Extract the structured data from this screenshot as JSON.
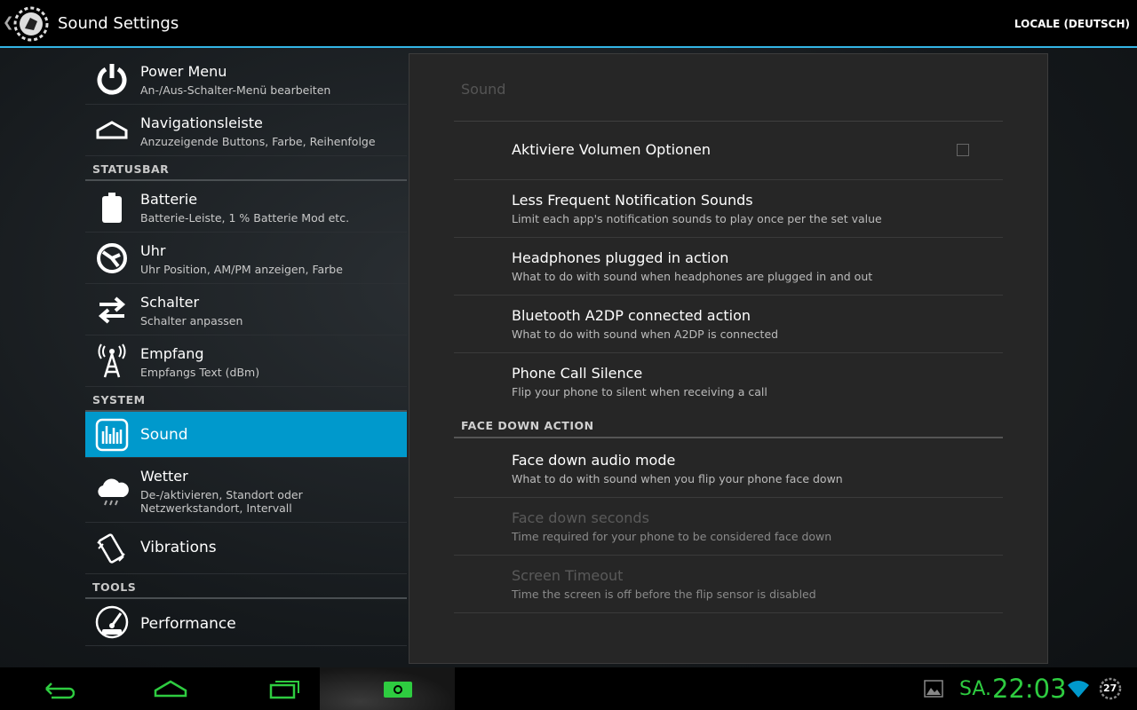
{
  "actionbar": {
    "title": "Sound Settings",
    "action": "LOCALE (DEUTSCH)",
    "back_glyph": "❮"
  },
  "sidebar": {
    "items": [
      {
        "title": "Power Menu",
        "subtitle": "An-/Aus-Schalter-Menü bearbeiten",
        "icon": "power-icon"
      },
      {
        "title": "Navigationsleiste",
        "subtitle": "Anzuzeigende Buttons, Farbe, Reihenfolge",
        "icon": "navbar-icon"
      },
      {
        "header": "STATUSBAR"
      },
      {
        "title": "Batterie",
        "subtitle": "Batterie-Leiste, 1 % Batterie Mod etc.",
        "icon": "battery-icon"
      },
      {
        "title": "Uhr",
        "subtitle": "Uhr Position, AM/PM anzeigen, Farbe",
        "icon": "clock-icon"
      },
      {
        "title": "Schalter",
        "subtitle": "Schalter anpassen",
        "icon": "toggle-arrows-icon"
      },
      {
        "title": "Empfang",
        "subtitle": "Empfangs Text (dBm)",
        "icon": "signal-tower-icon"
      },
      {
        "header": "SYSTEM"
      },
      {
        "title": "Sound",
        "icon": "sound-icon",
        "active": true
      },
      {
        "title": "Wetter",
        "subtitle": "De-/aktivieren, Standort oder Netzwerkstandort, Intervall",
        "icon": "weather-icon"
      },
      {
        "title": "Vibrations",
        "icon": "vibration-icon"
      },
      {
        "header": "TOOLS"
      },
      {
        "title": "Performance",
        "icon": "performance-gauge-icon"
      }
    ]
  },
  "panel": {
    "title": "Sound",
    "prefs": [
      {
        "title": "Aktiviere Volumen Optionen",
        "checkbox": false
      },
      {
        "title": "Less Frequent Notification Sounds",
        "subtitle": "Limit each app's notification sounds to play once per the set value"
      },
      {
        "title": "Headphones plugged in action",
        "subtitle": "What to do with sound when headphones are plugged in and out"
      },
      {
        "title": "Bluetooth A2DP connected action",
        "subtitle": "What to do with sound when A2DP is connected"
      },
      {
        "title": "Phone Call Silence",
        "subtitle": "Flip your phone to silent when receiving a call"
      }
    ],
    "category": "FACE DOWN ACTION",
    "face_prefs": [
      {
        "title": "Face down audio mode",
        "subtitle": "What to do with sound when you flip your phone face down",
        "enabled": true
      },
      {
        "title": "Face down seconds",
        "subtitle": "Time required for your phone to be considered face down",
        "enabled": false
      },
      {
        "title": "Screen Timeout",
        "subtitle": "Time the screen is off before the flip sensor is disabled",
        "enabled": false
      }
    ]
  },
  "systembar": {
    "day": "SA.",
    "time": "22:03",
    "notification_count": "27",
    "clock_color": "#2ecc40"
  },
  "colors": {
    "accent": "#33b5e5",
    "active_item": "#0099cc"
  }
}
